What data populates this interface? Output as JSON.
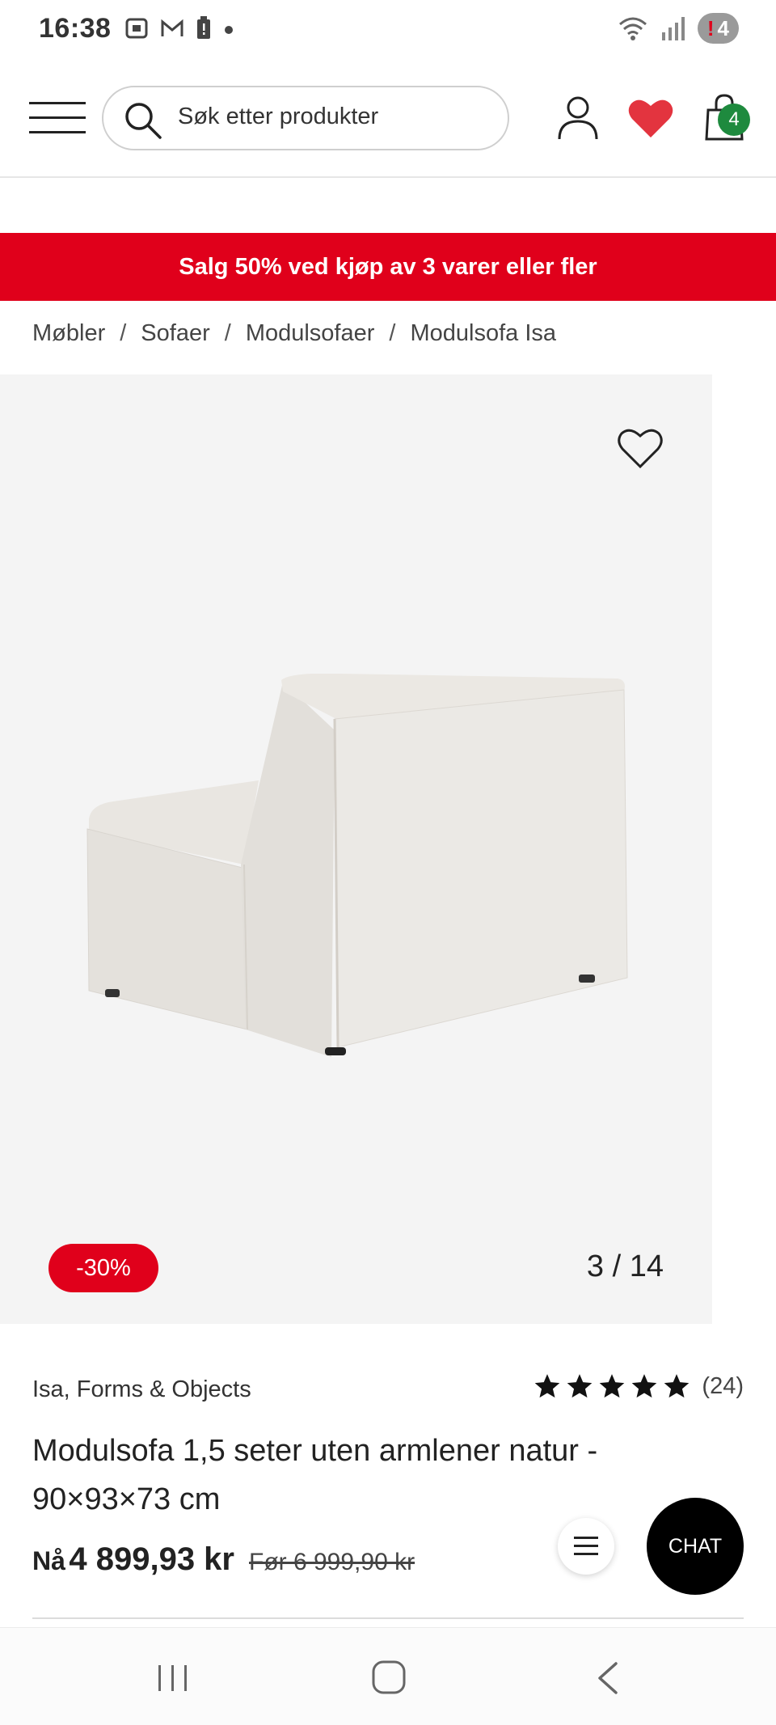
{
  "status_bar": {
    "time": "16:38",
    "battery_level": "4",
    "icons": [
      "screenshot-icon",
      "gmail-icon",
      "battery-alert-icon",
      "dot-icon",
      "wifi-icon",
      "signal-icon"
    ]
  },
  "header": {
    "search_placeholder": "Søk etter produkter",
    "cart_count": "4"
  },
  "sale_banner": "Salg 50% ved kjøp av 3 varer eller fler",
  "breadcrumb": [
    "Møbler",
    "Sofaer",
    "Modulsofaer",
    "Modulsofa Isa"
  ],
  "breadcrumb_separator": "/",
  "gallery": {
    "discount": "-30%",
    "counter": "3 / 14"
  },
  "product": {
    "brand": "Isa, Forms & Objects",
    "rating_stars": 5,
    "rating_count": "(24)",
    "title": "Modulsofa 1,5 seter uten armlener natur - 90×93×73 cm",
    "price_now_label": "Nå",
    "price_now": "4 899,93 kr",
    "price_before": "Før 6 999,90 kr"
  },
  "chat_label": "CHAT",
  "colors": {
    "accent_red": "#e0001b",
    "cart_badge_green": "#1e8a3e",
    "heart_red": "#e3343f"
  }
}
